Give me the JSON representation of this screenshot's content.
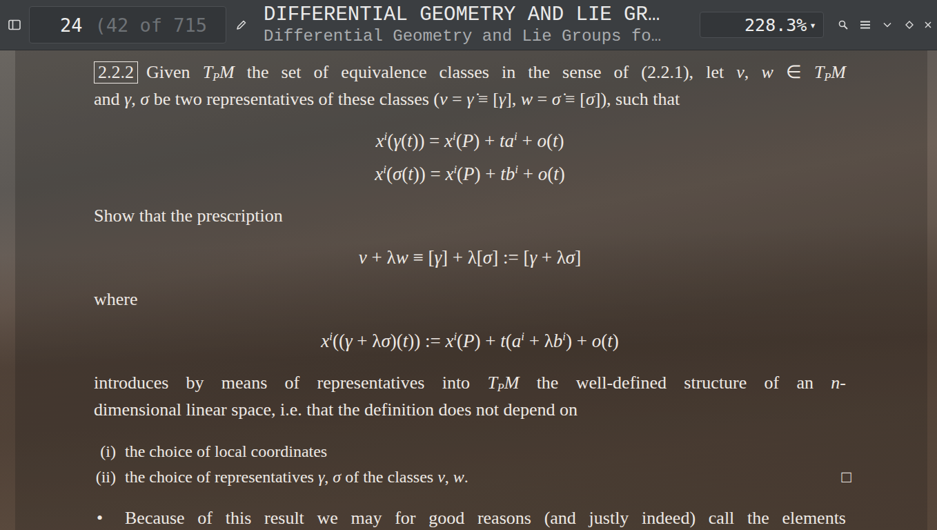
{
  "window": {
    "title": "DIFFERENTIAL GEOMETRY AND LIE GR…",
    "subtitle": "Differential Geometry and Lie Groups fo…"
  },
  "toolbar": {
    "page": "24",
    "page_info": "(42 of 715",
    "zoom": "228.3%",
    "zoom_arrow": "▾"
  },
  "document": {
    "blocks": [
      {
        "kind": "para",
        "lines": [
          {
            "justify": true,
            "runs": [
              [
                "2.2.2",
                "box"
              ],
              [
                "Given ",
                "r"
              ],
              [
                "T",
                "i"
              ],
              [
                "P",
                "sub"
              ],
              [
                "M",
                "i"
              ],
              [
                " the set of equivalence classes in the sense of (2.2.1), let ",
                "r"
              ],
              [
                "v",
                "i"
              ],
              [
                ", ",
                "r"
              ],
              [
                "w",
                "i"
              ],
              [
                " ∈ ",
                "r"
              ],
              [
                "T",
                "i"
              ],
              [
                "P",
                "sub"
              ],
              [
                "M",
                "i"
              ]
            ]
          },
          {
            "justify": false,
            "runs": [
              [
                "and ",
                "r"
              ],
              [
                "γ",
                "i"
              ],
              [
                ", ",
                "r"
              ],
              [
                "σ",
                "i"
              ],
              [
                " be two representatives of these classes (",
                "r"
              ],
              [
                "v",
                "i"
              ],
              [
                " = ",
                "r"
              ],
              [
                "γ̇",
                "i"
              ],
              [
                " ≡ [",
                "r"
              ],
              [
                "γ",
                "i"
              ],
              [
                "], ",
                "r"
              ],
              [
                "w",
                "i"
              ],
              [
                " = ",
                "r"
              ],
              [
                "σ̇",
                "i"
              ],
              [
                " ≡ [",
                "r"
              ],
              [
                "σ",
                "i"
              ],
              [
                "]), such that",
                "r"
              ]
            ]
          }
        ]
      },
      {
        "kind": "equation",
        "lines": [
          {
            "justify": false,
            "runs": [
              [
                "x",
                "i"
              ],
              [
                "i",
                "sup"
              ],
              [
                "(",
                "r"
              ],
              [
                "γ",
                "i"
              ],
              [
                "(",
                "r"
              ],
              [
                "t",
                "i"
              ],
              [
                ")) = ",
                "r"
              ],
              [
                "x",
                "i"
              ],
              [
                "i",
                "sup"
              ],
              [
                "(",
                "r"
              ],
              [
                "P",
                "i"
              ],
              [
                ") + ",
                "r"
              ],
              [
                "ta",
                "i"
              ],
              [
                "i",
                "sup"
              ],
              [
                " + ",
                "r"
              ],
              [
                "o",
                "i"
              ],
              [
                "(",
                "r"
              ],
              [
                "t",
                "i"
              ],
              [
                ")",
                "r"
              ]
            ]
          },
          {
            "justify": false,
            "runs": [
              [
                "x",
                "i"
              ],
              [
                "i",
                "sup"
              ],
              [
                "(",
                "r"
              ],
              [
                "σ",
                "i"
              ],
              [
                "(",
                "r"
              ],
              [
                "t",
                "i"
              ],
              [
                ")) = ",
                "r"
              ],
              [
                "x",
                "i"
              ],
              [
                "i",
                "sup"
              ],
              [
                "(",
                "r"
              ],
              [
                "P",
                "i"
              ],
              [
                ") + ",
                "r"
              ],
              [
                "tb",
                "i"
              ],
              [
                "i",
                "sup"
              ],
              [
                " + ",
                "r"
              ],
              [
                "o",
                "i"
              ],
              [
                "(",
                "r"
              ],
              [
                "t",
                "i"
              ],
              [
                ")",
                "r"
              ]
            ]
          }
        ]
      },
      {
        "kind": "para",
        "lines": [
          {
            "justify": false,
            "runs": [
              [
                "Show that the prescription",
                "r"
              ]
            ]
          }
        ]
      },
      {
        "kind": "equation",
        "lines": [
          {
            "justify": false,
            "runs": [
              [
                "v",
                "i"
              ],
              [
                " + λ",
                "r"
              ],
              [
                "w",
                "i"
              ],
              [
                " ≡ [",
                "r"
              ],
              [
                "γ",
                "i"
              ],
              [
                "] + λ[",
                "r"
              ],
              [
                "σ",
                "i"
              ],
              [
                "] := [",
                "r"
              ],
              [
                "γ",
                "i"
              ],
              [
                " + λ",
                "r"
              ],
              [
                "σ",
                "i"
              ],
              [
                "]",
                "r"
              ]
            ]
          }
        ]
      },
      {
        "kind": "para",
        "lines": [
          {
            "justify": false,
            "runs": [
              [
                "where",
                "r"
              ]
            ]
          }
        ]
      },
      {
        "kind": "equation",
        "lines": [
          {
            "justify": false,
            "runs": [
              [
                "x",
                "i"
              ],
              [
                "i",
                "sup"
              ],
              [
                "((",
                "r"
              ],
              [
                "γ",
                "i"
              ],
              [
                " + λ",
                "r"
              ],
              [
                "σ",
                "i"
              ],
              [
                ")(",
                "r"
              ],
              [
                "t",
                "i"
              ],
              [
                ")) := ",
                "r"
              ],
              [
                "x",
                "i"
              ],
              [
                "i",
                "sup"
              ],
              [
                "(",
                "r"
              ],
              [
                "P",
                "i"
              ],
              [
                ") + ",
                "r"
              ],
              [
                "t",
                "i"
              ],
              [
                "(",
                "r"
              ],
              [
                "a",
                "i"
              ],
              [
                "i",
                "sup"
              ],
              [
                " + λ",
                "r"
              ],
              [
                "b",
                "i"
              ],
              [
                "i",
                "sup"
              ],
              [
                ") + ",
                "r"
              ],
              [
                "o",
                "i"
              ],
              [
                "(",
                "r"
              ],
              [
                "t",
                "i"
              ],
              [
                ")",
                "r"
              ]
            ]
          }
        ]
      },
      {
        "kind": "para",
        "lines": [
          {
            "justify": true,
            "runs": [
              [
                "introduces by means of representatives into ",
                "r"
              ],
              [
                "T",
                "i"
              ],
              [
                "P",
                "sub"
              ],
              [
                "M",
                "i"
              ],
              [
                " the well-defined structure of an ",
                "r"
              ],
              [
                "n",
                "i"
              ],
              [
                "-",
                "r"
              ]
            ]
          },
          {
            "justify": false,
            "runs": [
              [
                "dimensional linear space, i.e. that the definition does not depend on",
                "r"
              ]
            ]
          }
        ]
      },
      {
        "kind": "list",
        "items": [
          {
            "label": "(i)",
            "end_mark": "",
            "runs": [
              [
                "the choice of local coordinates",
                "r"
              ]
            ]
          },
          {
            "label": "(ii)",
            "end_mark": "□",
            "runs": [
              [
                "the choice of representatives ",
                "r"
              ],
              [
                "γ",
                "i"
              ],
              [
                ", ",
                "r"
              ],
              [
                "σ",
                "i"
              ],
              [
                " of the classes ",
                "r"
              ],
              [
                "v",
                "i"
              ],
              [
                ", ",
                "r"
              ],
              [
                "w",
                "i"
              ],
              [
                ".",
                "r"
              ]
            ]
          }
        ]
      },
      {
        "kind": "bullet",
        "mark": "•",
        "lines": [
          {
            "justify": true,
            "runs": [
              [
                "Because of this result we may for good reasons (and justly indeed) call the elements",
                "r"
              ]
            ]
          }
        ]
      }
    ]
  }
}
